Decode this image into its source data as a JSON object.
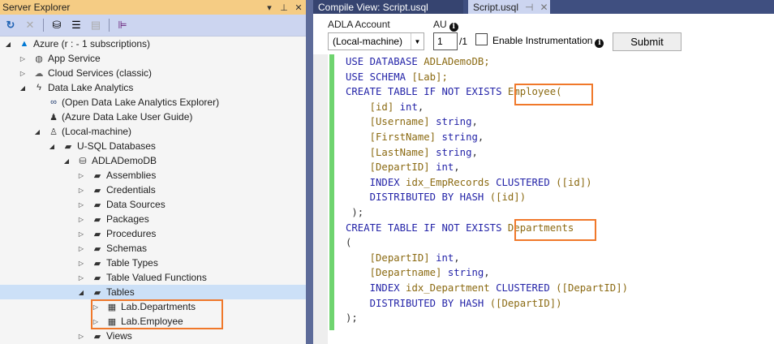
{
  "server_explorer": {
    "title": "Server Explorer",
    "toolbar": [
      "refresh-icon",
      "stop-icon",
      "connect-database-icon",
      "connect-server-icon",
      "add-icon",
      "properties-icon"
    ],
    "tree": [
      {
        "label": "Azure (r                                 : - 1 subscriptions)",
        "level": 0,
        "expand": "open",
        "icon": "azure-icon"
      },
      {
        "label": "App Service",
        "level": 1,
        "expand": "closed",
        "icon": "globe-icon"
      },
      {
        "label": "Cloud Services (classic)",
        "level": 1,
        "expand": "closed",
        "icon": "cloud-icon"
      },
      {
        "label": "Data Lake Analytics",
        "level": 1,
        "expand": "open",
        "icon": "lightning-icon"
      },
      {
        "label": "(Open Data Lake Analytics Explorer)",
        "level": 2,
        "expand": "none",
        "icon": "binoculars-icon"
      },
      {
        "label": "(Azure Data Lake User Guide)",
        "level": 2,
        "expand": "none",
        "icon": "user-guide-icon"
      },
      {
        "label": "(Local-machine)",
        "level": 2,
        "expand": "open",
        "icon": "user-icon"
      },
      {
        "label": "U-SQL Databases",
        "level": 3,
        "expand": "open",
        "icon": "folder-icon"
      },
      {
        "label": "ADLADemoDB",
        "level": 4,
        "expand": "open",
        "icon": "database-icon"
      },
      {
        "label": "Assemblies",
        "level": 5,
        "expand": "closed",
        "icon": "folder-icon"
      },
      {
        "label": "Credentials",
        "level": 5,
        "expand": "closed",
        "icon": "folder-icon"
      },
      {
        "label": "Data Sources",
        "level": 5,
        "expand": "closed",
        "icon": "folder-icon"
      },
      {
        "label": "Packages",
        "level": 5,
        "expand": "closed",
        "icon": "folder-icon"
      },
      {
        "label": "Procedures",
        "level": 5,
        "expand": "closed",
        "icon": "folder-icon"
      },
      {
        "label": "Schemas",
        "level": 5,
        "expand": "closed",
        "icon": "folder-icon"
      },
      {
        "label": "Table Types",
        "level": 5,
        "expand": "closed",
        "icon": "folder-icon"
      },
      {
        "label": "Table Valued Functions",
        "level": 5,
        "expand": "closed",
        "icon": "folder-icon"
      },
      {
        "label": "Tables",
        "level": 5,
        "expand": "open",
        "icon": "folder-icon",
        "selected": true
      },
      {
        "label": "Lab.Departments",
        "level": 6,
        "expand": "closed",
        "icon": "table-icon"
      },
      {
        "label": "Lab.Employee",
        "level": 6,
        "expand": "closed",
        "icon": "table-icon"
      },
      {
        "label": "Views",
        "level": 5,
        "expand": "closed",
        "icon": "folder-icon"
      }
    ]
  },
  "tabs": {
    "compile": "Compile View:  Script.usql",
    "active": "Script.usql"
  },
  "form": {
    "account_label": "ADLA Account",
    "account_value": "(Local-machine)",
    "au_label": "AU",
    "au_value": "1",
    "au_max": "/1",
    "instrumentation_label": "Enable Instrumentation",
    "submit": "Submit"
  },
  "code": [
    [
      [
        "USE DATABASE ",
        "k"
      ],
      [
        "ADLADemoDB;",
        "i"
      ]
    ],
    [
      [
        "USE SCHEMA ",
        "k"
      ],
      [
        "[Lab];",
        "i"
      ]
    ],
    [
      [
        "CREATE TABLE IF NOT EXISTS ",
        "k"
      ],
      [
        "Employee(",
        "i"
      ]
    ],
    [
      [
        "    [id] ",
        "i"
      ],
      [
        "int",
        "k"
      ],
      [
        ",",
        "p"
      ]
    ],
    [
      [
        "    [Username] ",
        "i"
      ],
      [
        "string",
        "k"
      ],
      [
        ",",
        "p"
      ]
    ],
    [
      [
        "    [FirstName] ",
        "i"
      ],
      [
        "string",
        "k"
      ],
      [
        ",",
        "p"
      ]
    ],
    [
      [
        "    [LastName] ",
        "i"
      ],
      [
        "string",
        "k"
      ],
      [
        ",",
        "p"
      ]
    ],
    [
      [
        "    [DepartID] ",
        "i"
      ],
      [
        "int",
        "k"
      ],
      [
        ",",
        "p"
      ]
    ],
    [
      [
        "    INDEX ",
        "k"
      ],
      [
        "idx_EmpRecords ",
        "i"
      ],
      [
        "CLUSTERED ",
        "k"
      ],
      [
        "([id])",
        "i"
      ]
    ],
    [
      [
        "    DISTRIBUTED BY HASH ",
        "k"
      ],
      [
        "([id])",
        "i"
      ]
    ],
    [
      [
        " );",
        "p"
      ]
    ],
    [
      [
        "CREATE TABLE IF NOT EXISTS ",
        "k"
      ],
      [
        "Departments",
        "i"
      ]
    ],
    [
      [
        "(",
        "p"
      ]
    ],
    [
      [
        "    [DepartID] ",
        "i"
      ],
      [
        "int",
        "k"
      ],
      [
        ",",
        "p"
      ]
    ],
    [
      [
        "    [Departname] ",
        "i"
      ],
      [
        "string",
        "k"
      ],
      [
        ",",
        "p"
      ]
    ],
    [
      [
        "    INDEX ",
        "k"
      ],
      [
        "idx_Department ",
        "i"
      ],
      [
        "CLUSTERED ",
        "k"
      ],
      [
        "([DepartID])",
        "i"
      ]
    ],
    [
      [
        "    DISTRIBUTED BY HASH ",
        "k"
      ],
      [
        "([DepartID])",
        "i"
      ]
    ],
    [
      [
        ");",
        "p"
      ]
    ]
  ]
}
